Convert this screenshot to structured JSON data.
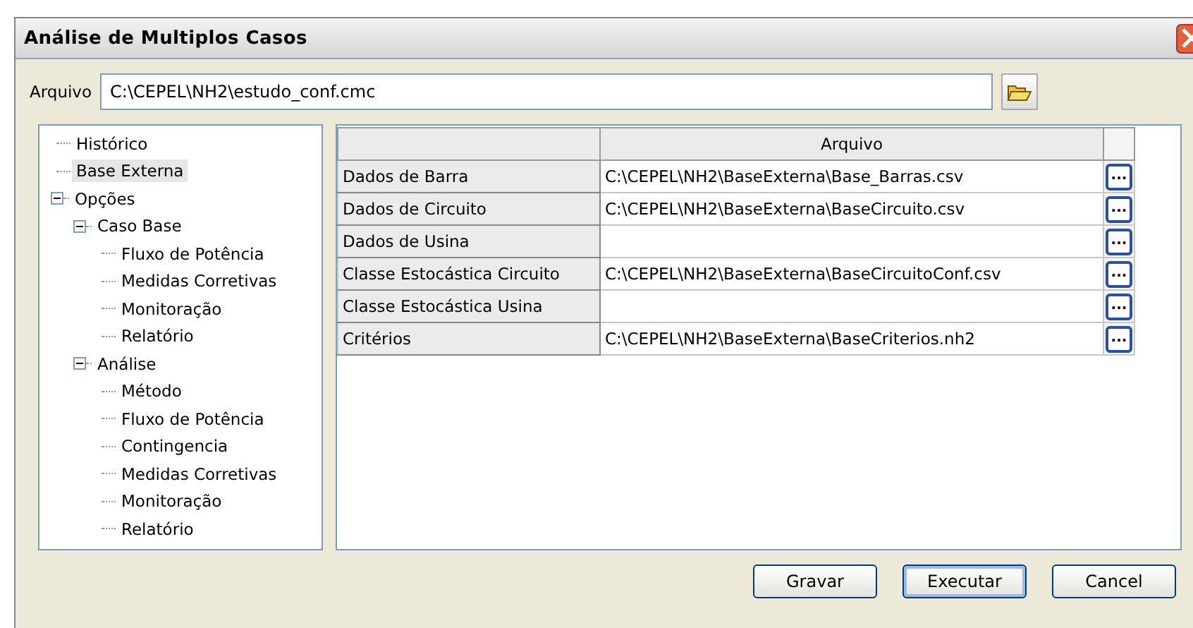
{
  "window": {
    "title": "Análise de Multiplos Casos"
  },
  "file": {
    "label": "Arquivo",
    "value": "C:\\CEPEL\\NH2\\estudo_conf.cmc"
  },
  "tree": [
    {
      "label": "Histórico",
      "selected": false
    },
    {
      "label": "Base Externa",
      "selected": true
    },
    {
      "label": "Opções",
      "selected": false,
      "expanded": true,
      "children": [
        {
          "label": "Caso Base",
          "selected": false,
          "expanded": true,
          "children": [
            {
              "label": "Fluxo de Potência",
              "selected": false
            },
            {
              "label": "Medidas Corretivas",
              "selected": false
            },
            {
              "label": "Monitoração",
              "selected": false
            },
            {
              "label": "Relatório",
              "selected": false
            }
          ]
        },
        {
          "label": "Análise",
          "selected": false,
          "expanded": true,
          "children": [
            {
              "label": "Método",
              "selected": false
            },
            {
              "label": "Fluxo de Potência",
              "selected": false
            },
            {
              "label": "Contingencia",
              "selected": false
            },
            {
              "label": "Medidas Corretivas",
              "selected": false
            },
            {
              "label": "Monitoração",
              "selected": false
            },
            {
              "label": "Relatório",
              "selected": false
            }
          ]
        }
      ]
    }
  ],
  "table": {
    "columns": [
      "Arquivo"
    ],
    "rows": [
      {
        "label": "Dados de Barra",
        "value": "C:\\CEPEL\\NH2\\BaseExterna\\Base_Barras.csv",
        "browse": "..."
      },
      {
        "label": "Dados de Circuito",
        "value": "C:\\CEPEL\\NH2\\BaseExterna\\BaseCircuito.csv",
        "browse": "..."
      },
      {
        "label": "Dados de Usina",
        "value": "",
        "browse": "..."
      },
      {
        "label": "Classe Estocástica Circuito",
        "value": "C:\\CEPEL\\NH2\\BaseExterna\\BaseCircuitoConf.csv",
        "browse": "..."
      },
      {
        "label": "Classe Estocástica Usina",
        "value": "",
        "browse": "..."
      },
      {
        "label": "Critérios",
        "value": "C:\\CEPEL\\NH2\\BaseExterna\\BaseCriterios.nh2",
        "browse": "..."
      }
    ]
  },
  "buttons": [
    {
      "label": "Gravar",
      "default": false
    },
    {
      "label": "Executar",
      "default": true
    },
    {
      "label": "Cancel",
      "default": false
    }
  ]
}
